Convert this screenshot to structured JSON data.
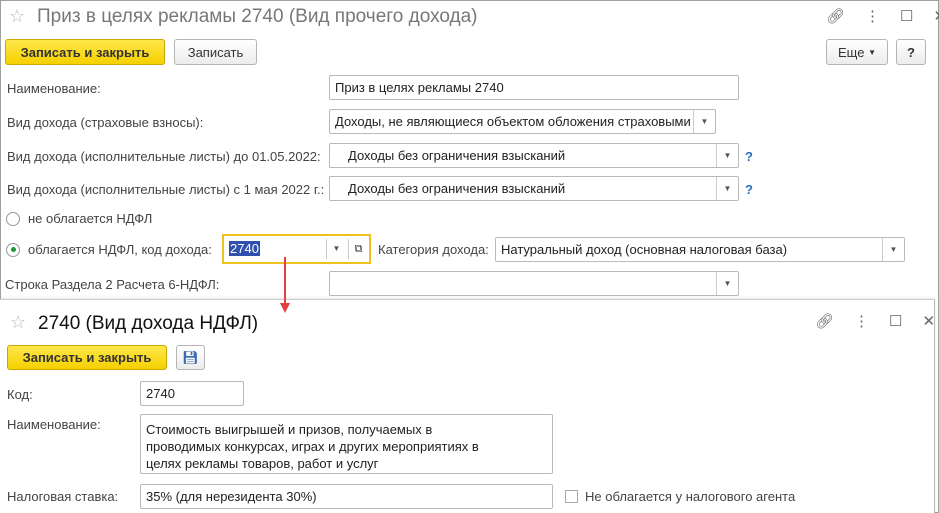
{
  "main": {
    "title": "Приз в целях рекламы 2740 (Вид прочего дохода)",
    "save_close": "Записать и закрыть",
    "save": "Записать",
    "more": "Еще",
    "help": "?",
    "fields": [
      {
        "label": "Наименование:",
        "value": "Приз в целях рекламы 2740"
      },
      {
        "label": "Вид дохода (страховые взносы):",
        "value": "Доходы, не являющиеся объектом обложения страховыми"
      },
      {
        "label": "Вид дохода (исполнительные листы) до 01.05.2022:",
        "value": "Доходы без ограничения взысканий"
      },
      {
        "label": "Вид дохода (исполнительные листы) с 1 мая 2022 г.:",
        "value": "Доходы без ограничения взысканий"
      }
    ],
    "radio_not_taxed": "не облагается НДФЛ",
    "radio_taxed": "облагается НДФЛ, код дохода:",
    "income_code": "2740",
    "category_label": "Категория дохода:",
    "category_value": "Натуральный доход (основная налоговая база)",
    "row6_label": "Строка Раздела 2 Расчета 6-НДФЛ:",
    "row6_value": ""
  },
  "sub": {
    "title": "2740 (Вид дохода НДФЛ)",
    "save_close": "Записать и закрыть",
    "code_label": "Код:",
    "code_value": "2740",
    "name_label": "Наименование:",
    "name_value": "Стоимость выигрышей и призов, получаемых в проводимых конкурсах, играх и других мероприятиях в целях рекламы товаров, работ и услуг",
    "rate_label": "Налоговая ставка:",
    "rate_value": "35% (для нерезидента 30%)",
    "agent_label": "Не облагается у налогового агента"
  },
  "colors": {
    "accent": "#f5d000",
    "focus": "#f0c020",
    "arrow": "#e04040"
  }
}
